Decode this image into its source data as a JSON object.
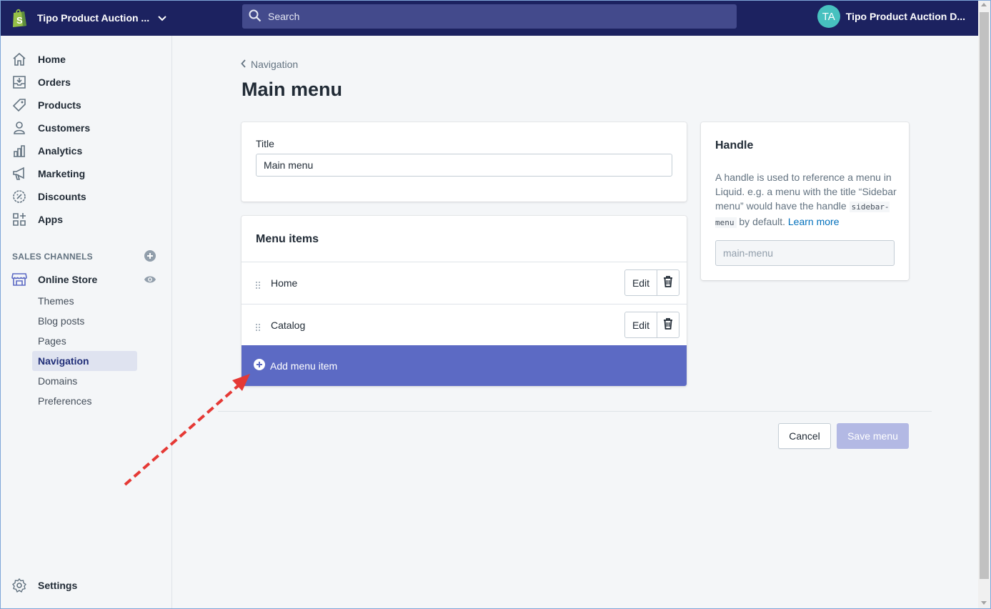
{
  "colors": {
    "topbar": "#1c2260",
    "search_bg": "#434a8c",
    "accent": "#5c6ac4",
    "avatar": "#47c1bf",
    "annotation_arrow": "#e53935",
    "link": "#006fbb"
  },
  "topbar": {
    "store_name": "Tipo Product Auction ...",
    "store_icon": "shopify-bag-icon",
    "search_placeholder": "Search",
    "avatar_initials": "TA",
    "user_name": "Tipo Product Auction D..."
  },
  "sidebar": {
    "items": [
      {
        "label": "Home",
        "icon": "home-icon"
      },
      {
        "label": "Orders",
        "icon": "orders-icon"
      },
      {
        "label": "Products",
        "icon": "tag-icon"
      },
      {
        "label": "Customers",
        "icon": "person-icon"
      },
      {
        "label": "Analytics",
        "icon": "bar-chart-icon"
      },
      {
        "label": "Marketing",
        "icon": "megaphone-icon"
      },
      {
        "label": "Discounts",
        "icon": "discount-icon"
      },
      {
        "label": "Apps",
        "icon": "apps-icon"
      }
    ],
    "sales_channels_label": "SALES CHANNELS",
    "online_store": "Online Store",
    "online_store_sub": [
      "Themes",
      "Blog posts",
      "Pages",
      "Navigation",
      "Domains",
      "Preferences"
    ],
    "active_sub": "Navigation",
    "settings": "Settings"
  },
  "main": {
    "breadcrumb": "Navigation",
    "title": "Main menu",
    "title_card": {
      "label": "Title",
      "value": "Main menu"
    },
    "menu_items": {
      "heading": "Menu items",
      "items": [
        {
          "label": "Home",
          "edit": "Edit"
        },
        {
          "label": "Catalog",
          "edit": "Edit"
        }
      ],
      "add_label": "Add menu item"
    },
    "handle": {
      "heading": "Handle",
      "desc_before": "A handle is used to reference a menu in Liquid. e.g. a menu with the title “Sidebar menu” would have the handle ",
      "code": "sidebar-menu",
      "desc_after": " by default. ",
      "learn_more": "Learn more",
      "value": "main-menu"
    },
    "actions": {
      "cancel": "Cancel",
      "save": "Save menu"
    }
  }
}
